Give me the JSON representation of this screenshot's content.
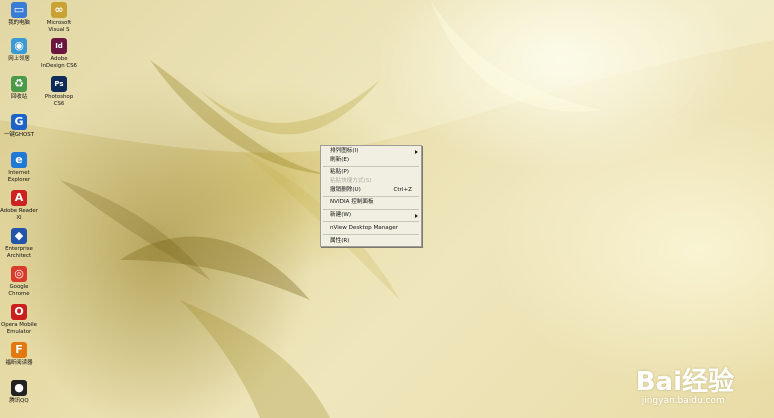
{
  "desktop": {
    "icons": [
      {
        "label": "我的电脑",
        "icon": "computer-icon",
        "color": "#3a7bd5"
      },
      {
        "label": "Microsoft\nVisual S",
        "icon": "visual-studio-icon",
        "color": "#c9a233"
      },
      {
        "label": "网上邻居",
        "icon": "network-icon",
        "color": "#3a9ad5"
      },
      {
        "label": "Adobe\nInDesign CS6",
        "icon": "indesign-icon",
        "color": "#6b1540"
      },
      {
        "label": "回收站",
        "icon": "recycle-bin-icon",
        "color": "#4a9a4a"
      },
      {
        "label": "Photoshop\nCS6",
        "icon": "photoshop-icon",
        "color": "#0e2b5a"
      },
      {
        "label": "一键GHOST",
        "icon": "ghost-icon",
        "color": "#1d63c8"
      },
      {
        "label": "Internet\nExplorer",
        "icon": "ie-icon",
        "color": "#1f7ad6"
      },
      {
        "label": "Adobe Reader\nXI",
        "icon": "adobe-reader-icon",
        "color": "#c22"
      },
      {
        "label": "Enterprise\nArchitect",
        "icon": "enterprise-architect-icon",
        "color": "#2255aa"
      },
      {
        "label": "Google\nChrome",
        "icon": "chrome-icon",
        "color": "#d93b2b"
      },
      {
        "label": "Opera Mobile\nEmulator",
        "icon": "opera-icon",
        "color": "#cc1f1f"
      },
      {
        "label": "福昕阅读器",
        "icon": "foxit-reader-icon",
        "color": "#e07a10"
      },
      {
        "label": "腾讯QQ",
        "icon": "qq-icon",
        "color": "#222"
      }
    ]
  },
  "context_menu": {
    "items": [
      {
        "label": "排列图标(I)",
        "submenu": true
      },
      {
        "label": "刷新(E)"
      },
      {
        "sep": true
      },
      {
        "label": "粘贴(P)"
      },
      {
        "label": "粘贴快捷方式(S)",
        "disabled": true
      },
      {
        "label": "撤销删除(U)",
        "shortcut": "Ctrl+Z"
      },
      {
        "sep": true
      },
      {
        "label": "NVIDIA 控制面板"
      },
      {
        "sep": true
      },
      {
        "label": "新建(W)",
        "submenu": true
      },
      {
        "sep": true
      },
      {
        "label": "nView Desktop Manager"
      },
      {
        "sep": true
      },
      {
        "label": "属性(R)"
      }
    ]
  },
  "watermark": {
    "text": "Bai经验",
    "url": "jingyan.baidu.com"
  }
}
